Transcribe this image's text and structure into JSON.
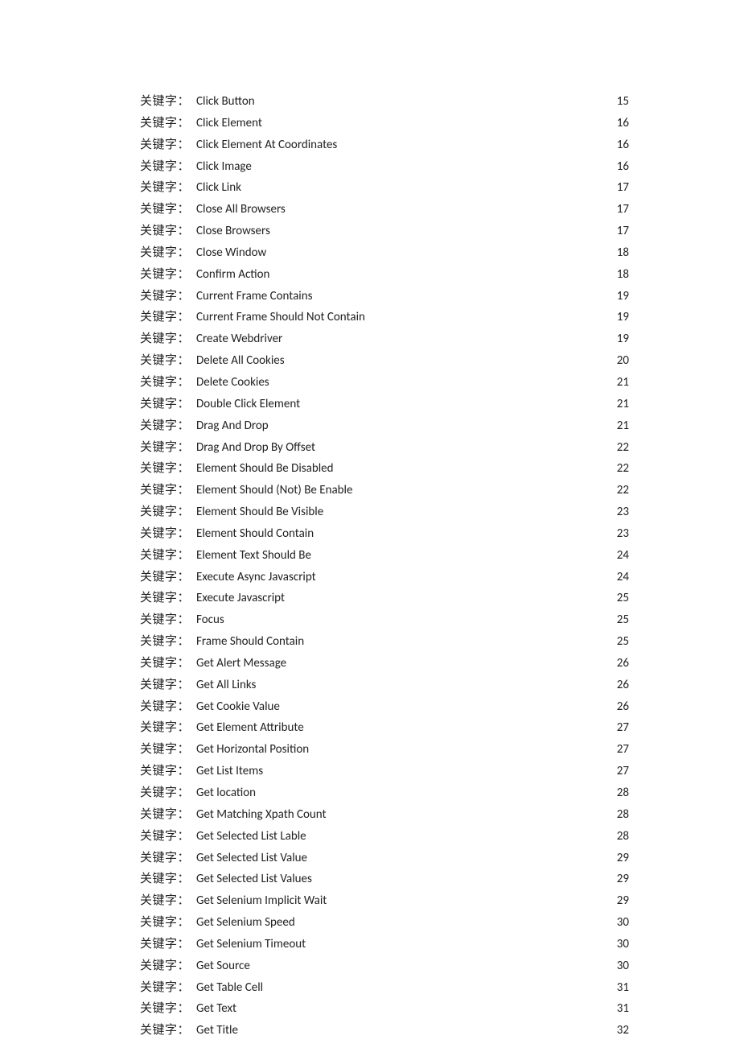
{
  "label_text": "关键字：",
  "entries": [
    {
      "title": "Click Button",
      "page": "15"
    },
    {
      "title": "Click Element",
      "page": "16"
    },
    {
      "title": "Click Element At Coordinates",
      "page": "16"
    },
    {
      "title": "Click Image",
      "page": "16"
    },
    {
      "title": "Click Link",
      "page": "17"
    },
    {
      "title": "Close All Browsers",
      "page": "17"
    },
    {
      "title": "Close Browsers",
      "page": "17"
    },
    {
      "title": "Close Window",
      "page": "18"
    },
    {
      "title": "Confirm Action",
      "page": "18"
    },
    {
      "title": "Current Frame Contains",
      "page": "19"
    },
    {
      "title": "Current Frame Should Not Contain",
      "page": "19"
    },
    {
      "title": "Create Webdriver",
      "page": "19"
    },
    {
      "title": "Delete All Cookies",
      "page": "20"
    },
    {
      "title": "Delete Cookies",
      "page": "21"
    },
    {
      "title": "Double Click Element",
      "page": "21"
    },
    {
      "title": "Drag And Drop",
      "page": "21"
    },
    {
      "title": "Drag And Drop By Offset",
      "page": "22"
    },
    {
      "title": "Element Should Be Disabled",
      "page": "22"
    },
    {
      "title": "Element Should (Not) Be Enable",
      "page": "22"
    },
    {
      "title": "Element Should Be Visible",
      "page": "23"
    },
    {
      "title": "Element Should Contain",
      "page": "23"
    },
    {
      "title": "Element Text Should Be",
      "page": "24"
    },
    {
      "title": "Execute Async Javascript",
      "page": "24"
    },
    {
      "title": "Execute Javascript",
      "page": "25"
    },
    {
      "title": "Focus",
      "page": "25"
    },
    {
      "title": "Frame Should Contain",
      "page": "25"
    },
    {
      "title": "Get Alert Message",
      "page": "26"
    },
    {
      "title": "Get All Links",
      "page": "26"
    },
    {
      "title": "Get Cookie Value",
      "page": "26"
    },
    {
      "title": "Get Element Attribute",
      "page": "27"
    },
    {
      "title": "Get Horizontal Position",
      "page": "27"
    },
    {
      "title": "Get List Items",
      "page": "27"
    },
    {
      "title": "Get location",
      "page": "28"
    },
    {
      "title": "Get Matching Xpath Count",
      "page": "28"
    },
    {
      "title": "Get Selected List Lable",
      "page": "28"
    },
    {
      "title": "Get Selected List Value",
      "page": "29"
    },
    {
      "title": "Get Selected List Values",
      "page": "29"
    },
    {
      "title": "Get Selenium Implicit Wait",
      "page": "29"
    },
    {
      "title": "Get Selenium Speed",
      "page": "30"
    },
    {
      "title": "Get Selenium Timeout",
      "page": "30"
    },
    {
      "title": "Get Source",
      "page": "30"
    },
    {
      "title": "Get Table Cell",
      "page": "31"
    },
    {
      "title": "Get Text",
      "page": "31"
    },
    {
      "title": "Get Title",
      "page": "32"
    }
  ]
}
